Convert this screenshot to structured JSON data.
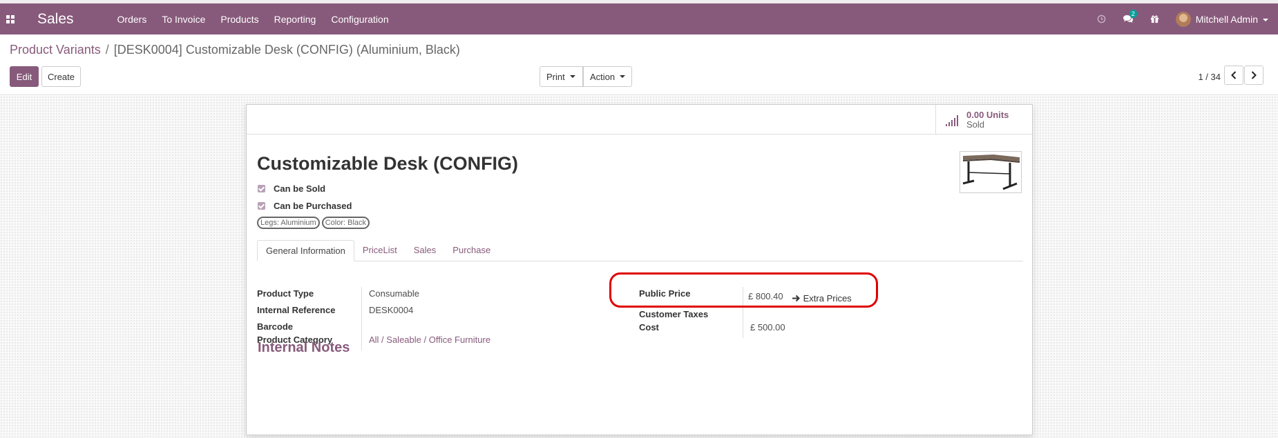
{
  "navbar": {
    "app_name": "Sales",
    "menu": [
      "Orders",
      "To Invoice",
      "Products",
      "Reporting",
      "Configuration"
    ],
    "message_count": "2",
    "user_name": "Mitchell Admin",
    "color": "#875a7b"
  },
  "breadcrumb": {
    "parent": "Product Variants",
    "current": "[DESK0004] Customizable Desk (CONFIG) (Aluminium, Black)"
  },
  "buttons": {
    "edit": "Edit",
    "create": "Create",
    "print": "Print",
    "action": "Action"
  },
  "pager": {
    "value": "1 / 34"
  },
  "stat": {
    "value": "0.00 Units",
    "label": "Sold"
  },
  "product": {
    "title": "Customizable Desk (CONFIG)",
    "can_be_sold": "Can be Sold",
    "can_be_purchased": "Can be Purchased",
    "tags": [
      "Legs: Aluminium",
      "Color: Black"
    ]
  },
  "tabs": [
    "General Information",
    "PriceList",
    "Sales",
    "Purchase"
  ],
  "fields_left": [
    {
      "label": "Product Type",
      "value": "Consumable"
    },
    {
      "label": "Internal Reference",
      "value": "DESK0004"
    },
    {
      "label": "Barcode",
      "value": ""
    },
    {
      "label": "Product Category",
      "value": "All / Saleable / Office Furniture"
    }
  ],
  "fields_right": {
    "public_price_label": "Public Price",
    "public_price_value": "£ 800.40",
    "extra_prices": "Extra Prices",
    "customer_taxes_label": "Customer Taxes",
    "cost_label": "Cost",
    "cost_value": "£ 500.00"
  },
  "notes_title": "Internal Notes"
}
